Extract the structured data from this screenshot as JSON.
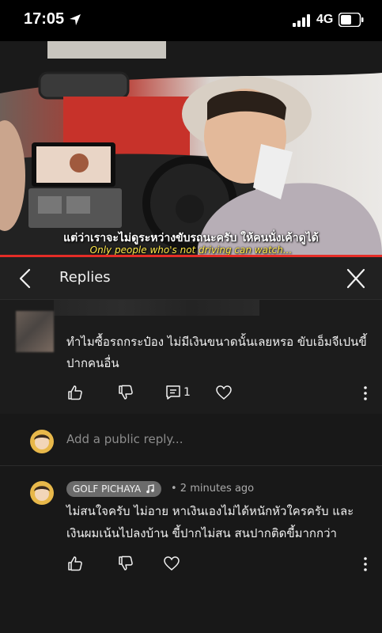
{
  "status_bar": {
    "time": "17:05",
    "network": "4G"
  },
  "video": {
    "subtitle_thai": "แต่ว่าเราจะไม่ดูระหว่างขับรถนะครับ ให้คนนั่งเค้าดูได้",
    "subtitle_english": "Only people who's not driving can watch...",
    "progress_fraction": 1.0
  },
  "header": {
    "title": "Replies"
  },
  "parent_comment": {
    "text": "ทำไมซื้อรถกระป๋อง ไม่มีเงินขนาดนั้นเลยหรอ ขับเอ็มจีเปนขี้ปากคนอื่น",
    "reply_count": "1"
  },
  "add_reply": {
    "placeholder": "Add a public reply..."
  },
  "reply": {
    "author": "GOLF PICHAYA",
    "time": "• 2 minutes ago",
    "text": "ไม่สนใจครับ ไม่อาย หาเงินเองไม่ได้หนักหัวใครครับ และเงินผมเน้นไปลงบ้าน ขี้ปากไม่สน สนปากติดขี้มากกว่า"
  },
  "colors": {
    "background": "#181818",
    "header": "#212121",
    "progress": "#e52d27",
    "subtitle_en": "#ffe84a",
    "badge": "#6b6b6b"
  }
}
